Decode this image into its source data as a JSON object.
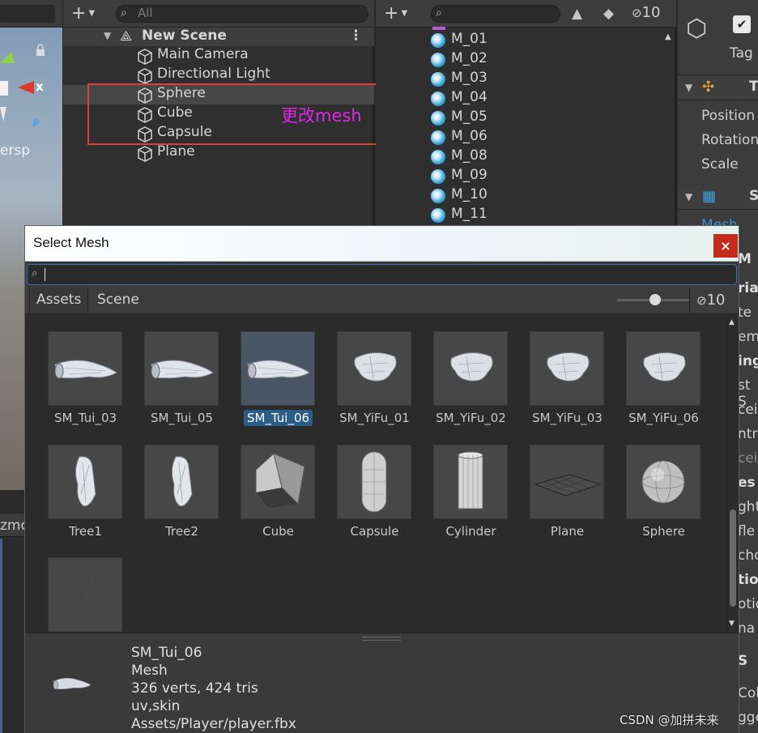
{
  "scene_view": {
    "label": "ersp",
    "axis_label": "x",
    "bottom_tab": "zmo"
  },
  "hierarchy": {
    "search_placeholder": "All",
    "scene_name": "New Scene",
    "items": [
      {
        "label": "Main Camera"
      },
      {
        "label": "Directional Light"
      },
      {
        "label": "Sphere",
        "selected": true
      },
      {
        "label": "Cube"
      },
      {
        "label": "Capsule"
      },
      {
        "label": "Plane"
      }
    ],
    "annotation": "更改mesh",
    "highlight_color": "#e23c3c",
    "annotation_color": "#e226e6"
  },
  "project": {
    "hidden_count": "10",
    "materials": [
      "M_01",
      "M_02",
      "M_03",
      "M_04",
      "M_05",
      "M_06",
      "M_08",
      "M_09",
      "M_10",
      "M_11"
    ]
  },
  "inspector": {
    "tag_label": "Tag",
    "transform_cut": "T",
    "fields": [
      "Position",
      "Rotation",
      "Scale"
    ],
    "mesh_filter_cut": "S",
    "mesh_cut": "Mesh",
    "fragments": [
      {
        "t": "M",
        "style": "b"
      },
      {
        "t": "ria",
        "style": "b"
      },
      {
        "t": "te",
        "style": ""
      },
      {
        "t": "eme",
        "style": ""
      },
      {
        "t": "ing",
        "style": "b"
      },
      {
        "t": "st S",
        "style": ""
      },
      {
        "t": "cei",
        "style": ""
      },
      {
        "t": "ntr",
        "style": ""
      },
      {
        "t": "cei",
        "style": "dim"
      },
      {
        "t": "es",
        "style": "b"
      },
      {
        "t": "ght",
        "style": ""
      },
      {
        "t": "fle",
        "style": ""
      },
      {
        "t": "cho",
        "style": ""
      },
      {
        "t": "tio",
        "style": "b"
      },
      {
        "t": "otio",
        "style": ""
      },
      {
        "t": "na",
        "style": ""
      },
      {
        "t": "S",
        "style": "b"
      },
      {
        "t": "Coll",
        "style": ""
      },
      {
        "t": "gge",
        "style": ""
      }
    ]
  },
  "dialog": {
    "title": "Select Mesh",
    "close_glyph": "×",
    "tabs": [
      {
        "label": "Assets",
        "active": true
      },
      {
        "label": "Scene",
        "active": false
      }
    ],
    "hidden_count": "10",
    "assets": [
      {
        "name": "SM_Tui_03",
        "icon": "leg-mesh-icon"
      },
      {
        "name": "SM_Tui_05",
        "icon": "leg-mesh-icon"
      },
      {
        "name": "SM_Tui_06",
        "icon": "leg-mesh-icon",
        "selected": true
      },
      {
        "name": "SM_YiFu_01",
        "icon": "cloth-mesh-icon"
      },
      {
        "name": "SM_YiFu_02",
        "icon": "cloth-mesh-icon"
      },
      {
        "name": "SM_YiFu_03",
        "icon": "cloth-mesh-icon"
      },
      {
        "name": "SM_YiFu_06",
        "icon": "cloth-mesh-icon"
      },
      {
        "name": "Tree1",
        "icon": "tree-mesh-icon"
      },
      {
        "name": "Tree2",
        "icon": "tree-mesh-icon"
      },
      {
        "name": "Cube",
        "icon": "cube-mesh-icon"
      },
      {
        "name": "Capsule",
        "icon": "capsule-mesh-icon"
      },
      {
        "name": "Cylinder",
        "icon": "cylinder-mesh-icon"
      },
      {
        "name": "Plane",
        "icon": "plane-mesh-icon"
      },
      {
        "name": "Sphere",
        "icon": "sphere-mesh-icon"
      },
      {
        "name": "",
        "icon": "quad-mesh-icon"
      }
    ],
    "details": {
      "name": "SM_Tui_06",
      "type": "Mesh",
      "stats": "326 verts, 424 tris",
      "channels": "uv,skin",
      "path": "Assets/Player/player.fbx"
    },
    "watermark": "CSDN @加拼未来"
  }
}
